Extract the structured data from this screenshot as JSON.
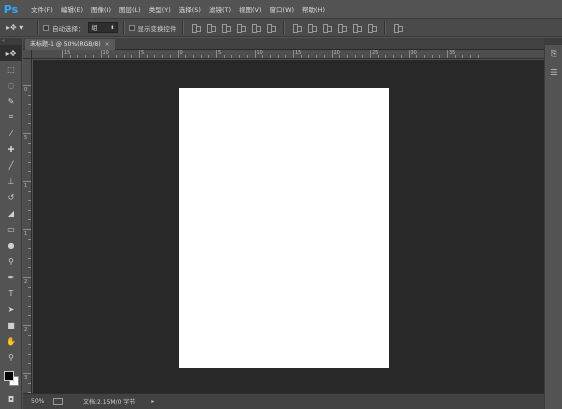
{
  "app": {
    "logo": "Ps"
  },
  "menu": [
    "文件(F)",
    "编辑(E)",
    "图像(I)",
    "图层(L)",
    "类型(Y)",
    "选择(S)",
    "滤镜(T)",
    "视图(V)",
    "窗口(W)",
    "帮助(H)"
  ],
  "options": {
    "tool_icon": "move-tool-icon",
    "auto_select_label": "自动选择：",
    "auto_select_value": "组",
    "transform_controls_label": "显示变换控件"
  },
  "document": {
    "tab_title": "未标题-1 @ 50%(RGB/8)",
    "close_glyph": "×"
  },
  "ruler_h_labels": [
    "15",
    "10",
    "5",
    "0",
    "5",
    "10",
    "15",
    "20",
    "25",
    "30",
    "35"
  ],
  "ruler_v_labels": [
    "0",
    "5",
    "1",
    "1",
    "2",
    "2",
    "3"
  ],
  "status": {
    "zoom": "50%",
    "doc_info": "文档:2.15M/0 字节",
    "arrow": "▸"
  },
  "colors": {
    "foreground": "#000000",
    "background": "#ffffff",
    "canvas": "#ffffff",
    "workspace": "#282828"
  }
}
